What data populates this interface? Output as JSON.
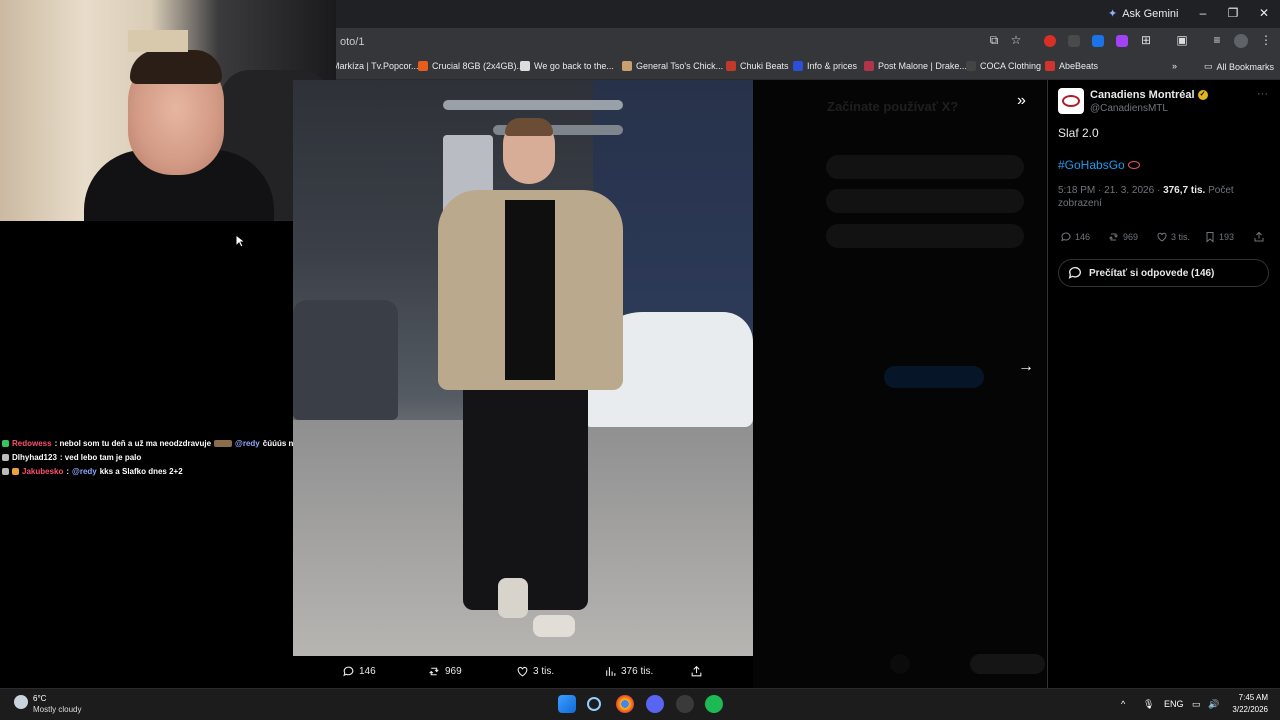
{
  "browser": {
    "url": "oto/1",
    "ask_gemini": "Ask Gemini",
    "bookmarks": [
      {
        "label": "Markíza | Tv.Popcor...",
        "color": "#888888"
      },
      {
        "label": "Crucial 8GB (2x4GB)...",
        "color": "#e85c1c"
      },
      {
        "label": "We go back to the...",
        "color": "#dddddd"
      },
      {
        "label": "General Tso's Chick...",
        "color": "#c8a070"
      },
      {
        "label": "Chuki Beats",
        "color": "#c0392b"
      },
      {
        "label": "Info & prices",
        "color": "#2b4fd6"
      },
      {
        "label": "Post Malone | Drake...",
        "color": "#b0344a"
      },
      {
        "label": "COCA Clothing",
        "color": "#444444"
      },
      {
        "label": "AbeBeats",
        "color": "#d0342c"
      }
    ],
    "all_bookmarks": "All Bookmarks"
  },
  "chat": [
    {
      "user": "Redowess",
      "msg": ": nebol som tu deň a už ma neodzdravuje",
      "mention": "@redy",
      "tail": "čúúús nie"
    },
    {
      "user": "Dlhyhad123",
      "msg": ": ved lebo tam je palo",
      "mention": "",
      "tail": ""
    },
    {
      "user": "Jakubesko",
      "msg": ":",
      "mention": "@redy",
      "tail": "kks a Slafko dnes 2+2"
    }
  ],
  "modal": {
    "ghost_title": "Začínate používať X?",
    "photo_actions": {
      "replies": "146",
      "reposts": "969",
      "likes": "3 tis.",
      "views": "376 tis."
    }
  },
  "tweet": {
    "name": "Canadiens Montréal",
    "handle": "@CanadiensMTL",
    "text": "Slaf 2.0",
    "hashtag": "#GoHabsGo",
    "time": "5:18 PM · 21. 3. 2026 ·",
    "views": "376,7 tis.",
    "views_label": "Počet zobrazení",
    "replies": "146",
    "reposts": "969",
    "likes": "3 tis.",
    "bookmarks": "193",
    "read_replies": "Prečítať si odpovede (146)"
  },
  "taskbar": {
    "temp": "6°C",
    "weather": "Mostly cloudy",
    "lang": "ENG",
    "time": "7:45 AM",
    "date": "3/22/2026"
  }
}
